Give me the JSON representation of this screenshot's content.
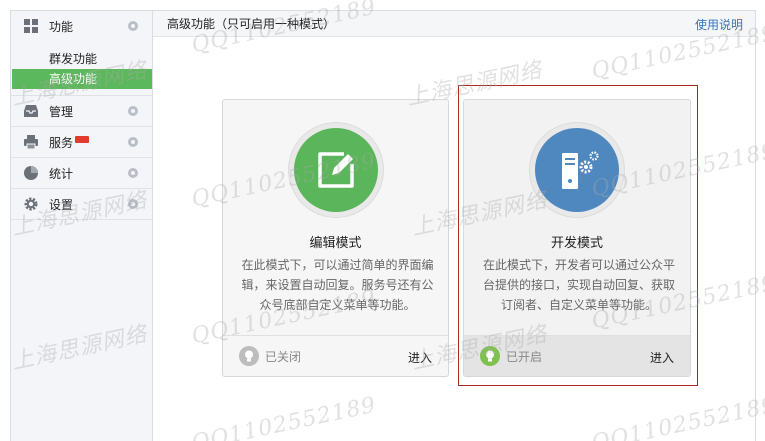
{
  "sidebar": {
    "groups": [
      {
        "label": "功能",
        "icon": "grid-icon",
        "items": [
          "群发功能",
          "高级功能"
        ]
      },
      {
        "label": "管理",
        "icon": "inbox-icon"
      },
      {
        "label": "服务",
        "icon": "printer-icon",
        "badge": "new"
      },
      {
        "label": "统计",
        "icon": "pie-chart-icon"
      },
      {
        "label": "设置",
        "icon": "gear-icon"
      }
    ],
    "active_item": "高级功能"
  },
  "header": {
    "title": "高级功能（只可启用一种模式）",
    "help_link": "使用说明"
  },
  "cards": [
    {
      "title": "编辑模式",
      "icon": "edit-icon",
      "description": "在此模式下，可以通过简单的界面编辑，来设置自动回复。服务号还有公众号底部自定义菜单等功能。",
      "status": "已关闭",
      "action": "进入",
      "enabled": false
    },
    {
      "title": "开发模式",
      "icon": "server-gear-icon",
      "description": "在此模式下，开发者可以通过公众平台提供的接口，实现自动回复、获取订阅者、自定义菜单等功能。",
      "status": "已开启",
      "action": "进入",
      "enabled": true
    }
  ],
  "watermarks": [
    "QQ1102552189",
    "上海思源网络"
  ],
  "colors": {
    "active_green": "#5cb85c",
    "link_blue": "#3a73b7",
    "highlight_red": "#a82b25",
    "dev_blue": "#4f88bf"
  }
}
